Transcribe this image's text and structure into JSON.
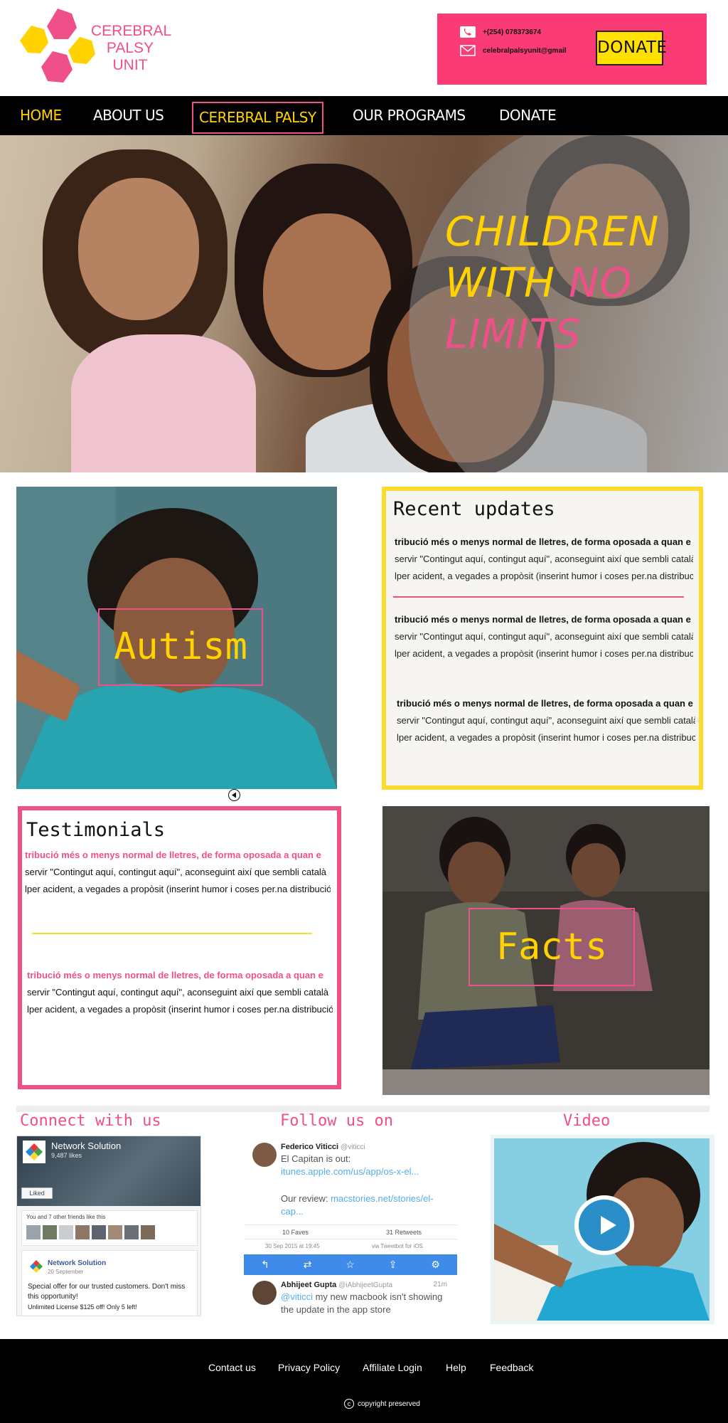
{
  "header": {
    "logo_lines": [
      "CEREBRAL",
      "PALSY",
      "UNIT"
    ],
    "phone": "+(254) 078373674",
    "email": "celebralpalsyunit@gmail",
    "donate_label": "DONATE"
  },
  "nav": {
    "items": [
      {
        "label": "HOME"
      },
      {
        "label": "ABOUT US"
      },
      {
        "label": "CEREBRAL PALSY"
      },
      {
        "label": "OUR PROGRAMS"
      },
      {
        "label": "DONATE"
      }
    ]
  },
  "hero": {
    "line1": "CHILDREN",
    "line2_a": "WITH ",
    "line2_b": "NO",
    "line3": "LIMITS"
  },
  "autism": {
    "label": "Autism"
  },
  "updates": {
    "title": "Recent updates",
    "items": [
      {
        "bold": "tribució més o menys normal de lletres, de forma oposada a quan e",
        "line2": "servir \"Contingut aquí, contingut aquí\", aconseguint així que sembli català",
        "line3": "lper acident, a vegades a propòsit (inserint humor i coses per.na distribució"
      },
      {
        "bold": "tribució més o menys normal de lletres, de forma oposada a quan e",
        "line2": "servir \"Contingut aquí, contingut aquí\", aconseguint així que sembli català",
        "line3": "lper acident, a vegades a propòsit (inserint humor i coses per.na distribució"
      },
      {
        "bold": "tribució més o menys normal de lletres, de forma oposada a quan e",
        "line2": "servir \"Contingut aquí, contingut aquí\", aconseguint així que sembli català",
        "line3": "lper acident, a vegades a propòsit (inserint humor i coses per.na distribució"
      }
    ]
  },
  "testimonials": {
    "title": "Testimonials",
    "items": [
      {
        "bold": "tribució més o menys normal de lletres, de forma oposada a quan e",
        "line2": "servir \"Contingut aquí, contingut aquí\", aconseguint així que sembli català",
        "line3": "lper acident, a vegades a propòsit (inserint humor i coses per.na distribució"
      },
      {
        "bold": "tribució més o menys normal de lletres, de forma oposada a quan e",
        "line2": "servir \"Contingut aquí, contingut aquí\", aconseguint així que sembli català",
        "line3": "lper acident, a vegades a propòsit (inserint humor i coses per.na distribució"
      }
    ]
  },
  "facts": {
    "label": "Facts"
  },
  "social": {
    "connect_title": "Connect with us",
    "follow_title": "Follow us on",
    "video_title": "Video",
    "facebook": {
      "page_name": "Network Solution",
      "likes": "9,487 likes",
      "liked_label": "Liked",
      "friends_text": "You and 7 other friends like this",
      "post_author": "Network Solution",
      "post_date": "20 September",
      "post_text": "Special offer for our trusted customers. Don't miss this opportunity!",
      "post_offer": "Unlimited License $125 off! Only 5 left!"
    },
    "twitter": {
      "tweet1_name": "Federico Viticci",
      "tweet1_handle": "@viticci",
      "tweet1_text": "El Capitan is out: ",
      "tweet1_link": "itunes.apple.com/us/app/os-x-el...",
      "tweet1_review": "Our review: ",
      "tweet1_review_link": "macstories.net/stories/el-cap...",
      "faves": "10 Faves",
      "retweets": "31 Retweets",
      "date": "30 Sep 2015 at 19:45",
      "via": "via Tweetbot for iOS",
      "tweet2_name": "Abhijeet Gupta",
      "tweet2_handle": "@iAbhijeetGupta",
      "tweet2_time": "21m",
      "tweet2_mention": "@viticci",
      "tweet2_text": " my new macbook isn't showing the update in the app store"
    }
  },
  "footer": {
    "links": [
      "Contact us",
      "Privacy Policy",
      "Affiliate Login",
      "Help",
      "Feedback"
    ],
    "copyright_symbol": "c",
    "copyright": "copyright preserved"
  },
  "colors": {
    "pink": "#f0508a",
    "hot_pink": "#fb3b76",
    "yellow": "#ffd200",
    "border_yellow": "#fddb2c",
    "black": "#000000"
  },
  "icons": [
    "phone-icon",
    "mail-icon",
    "prev-arrow-icon",
    "play-icon",
    "copyright-icon"
  ]
}
